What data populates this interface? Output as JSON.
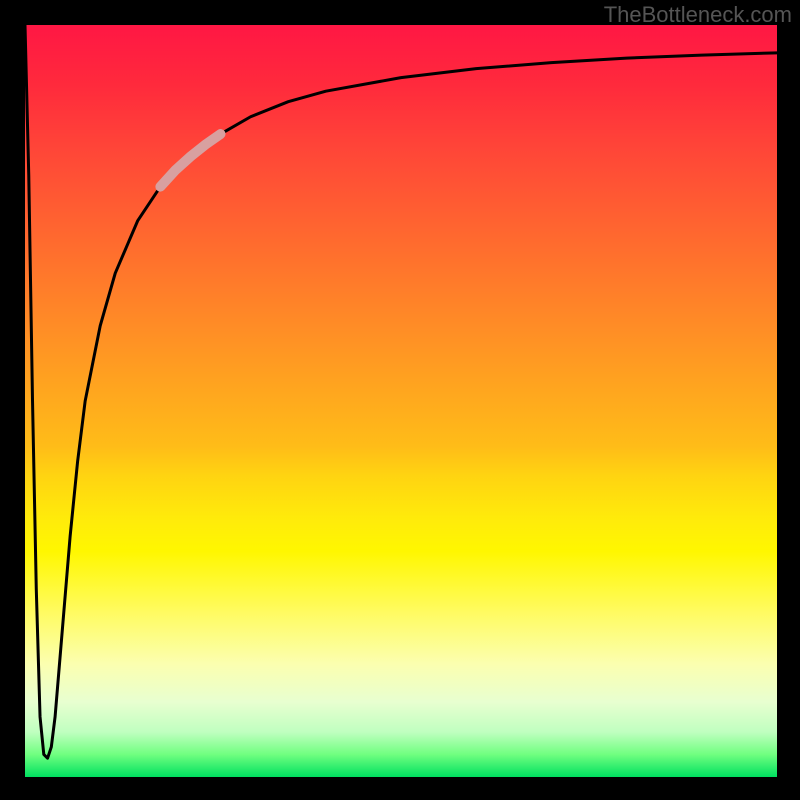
{
  "attribution": "TheBottleneck.com",
  "chart_data": {
    "type": "line",
    "title": "",
    "xlabel": "",
    "ylabel": "",
    "xlim": [
      0,
      100
    ],
    "ylim": [
      0,
      100
    ],
    "grid": false,
    "legend": false,
    "series": [
      {
        "name": "bottleneck-curve",
        "color": "#000000",
        "x": [
          0.0,
          0.5,
          1.0,
          1.5,
          2.0,
          2.5,
          3.0,
          3.5,
          4.0,
          4.5,
          5.0,
          6.0,
          7.0,
          8.0,
          10.0,
          12.0,
          15.0,
          18.0,
          22.0,
          26.0,
          30.0,
          35.0,
          40.0,
          50.0,
          60.0,
          70.0,
          80.0,
          90.0,
          100.0
        ],
        "y": [
          100.0,
          80.0,
          50.0,
          25.0,
          8.0,
          3.0,
          2.5,
          4.0,
          8.0,
          14.0,
          20.0,
          32.0,
          42.0,
          50.0,
          60.0,
          67.0,
          74.0,
          78.5,
          82.5,
          85.5,
          87.8,
          89.8,
          91.2,
          93.0,
          94.2,
          95.0,
          95.6,
          96.0,
          96.3
        ]
      },
      {
        "name": "highlight-segment",
        "color": "#d8a0a0",
        "stroke_width": 10,
        "x": [
          18.0,
          20.0,
          22.0,
          24.0,
          26.0
        ],
        "y": [
          78.5,
          80.7,
          82.5,
          84.1,
          85.5
        ]
      }
    ],
    "gradient_stops": [
      {
        "offset": 0.0,
        "color": "#ff1744"
      },
      {
        "offset": 0.5,
        "color": "#ffa41f"
      },
      {
        "offset": 0.7,
        "color": "#fff700"
      },
      {
        "offset": 0.9,
        "color": "#e8ffd0"
      },
      {
        "offset": 1.0,
        "color": "#00e060"
      }
    ]
  }
}
